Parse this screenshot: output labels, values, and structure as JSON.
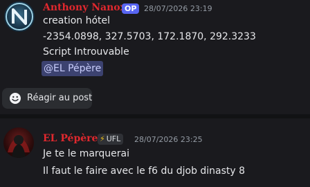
{
  "post": {
    "author": "Anthony Nanox",
    "badge": "OP",
    "timestamp": "28/07/2026 23:19",
    "lines": [
      "creation hótel",
      "-2354.0898, 327.5703, 172.1870, 292.3233",
      "Script Introuvable"
    ],
    "mention": "@EL Pépère",
    "react_label": "Réagir au post"
  },
  "reply": {
    "author": "EL Pépère",
    "tag": "UFL",
    "timestamp": "28/07/2026 23:25",
    "lines": [
      "Je te le marquerai",
      "Il faut le faire avec le f6 du djob dinasty 8"
    ]
  },
  "colors": {
    "background": "#1a1a1e",
    "username": "#e0282e",
    "op_badge": "#5865f2",
    "mention_bg": "#3c4270"
  }
}
